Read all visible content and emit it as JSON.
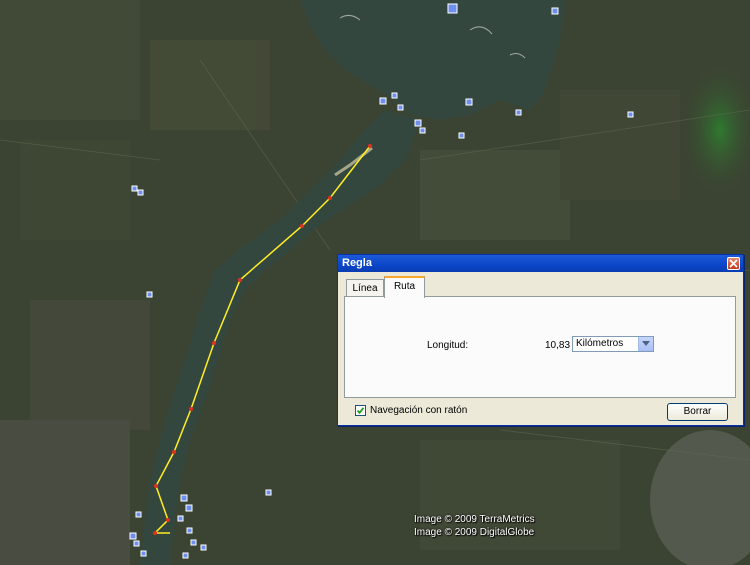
{
  "map": {
    "copyright_lines": [
      "Image © 2009 TerraMetrics",
      "Image © 2009 DigitalGlobe"
    ],
    "route_color": "#ffee22",
    "vertex_color": "#e03020",
    "water_color": "#34473f",
    "terrain_color": "#3b4432"
  },
  "dialog": {
    "title": "Regla",
    "tabs": [
      {
        "label": "Línea",
        "active": false
      },
      {
        "label": "Ruta",
        "active": true
      }
    ],
    "length_label": "Longitud:",
    "length_value": "10,83",
    "unit_selected": "Kilómetros",
    "nav_checkbox": {
      "label": "Navegación con ratón",
      "checked": true
    },
    "clear_label": "Borrar"
  }
}
